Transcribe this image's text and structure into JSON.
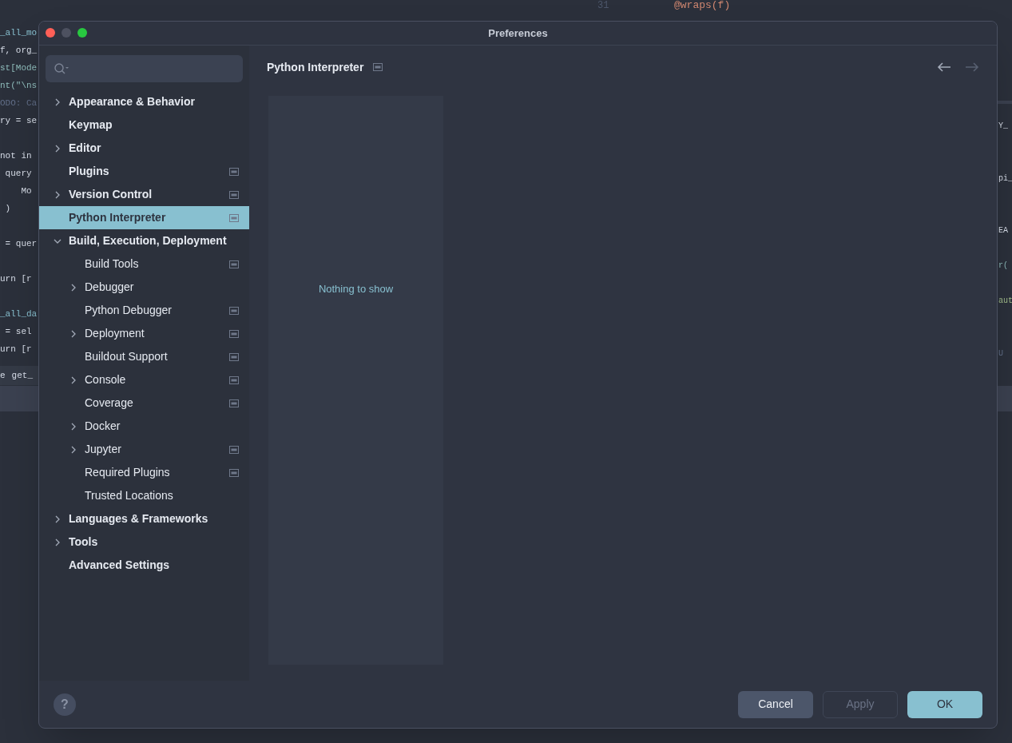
{
  "background_editor": {
    "line_number": "31",
    "top_code": "@wraps(f)",
    "left_lines": [
      {
        "text": "_all_mo",
        "kind": "name"
      },
      {
        "text": "f, org_",
        "kind": "plain"
      },
      {
        "text": "st[Mode",
        "kind": "type"
      },
      {
        "text": "nt(\"\\ns",
        "kind": "type"
      },
      {
        "text": "ODO: Ca",
        "kind": "comment"
      },
      {
        "text": "ry = se",
        "kind": "plain"
      },
      {
        "kind": "blank"
      },
      {
        "text": "not in",
        "kind": "plain"
      },
      {
        "text": " query",
        "kind": "plain"
      },
      {
        "text": "    Mo",
        "kind": "plain"
      },
      {
        "text": " )",
        "kind": "plain"
      },
      {
        "kind": "blank"
      },
      {
        "text": " = quer",
        "kind": "plain"
      },
      {
        "kind": "blank"
      },
      {
        "text": "urn [r",
        "kind": "plain"
      },
      {
        "kind": "blank"
      },
      {
        "text": "_all_da",
        "kind": "name"
      },
      {
        "text": " = sel",
        "kind": "plain"
      },
      {
        "text": "urn [r",
        "kind": "plain"
      }
    ],
    "breadcrumbs": [
      "e",
      "get_"
    ],
    "right_lines": [
      {
        "text": "Y_",
        "kind": "plain"
      },
      {
        "text": "pi_",
        "kind": "plain"
      },
      {
        "text": "EA",
        "kind": "plain"
      },
      {
        "text": "r(",
        "kind": "type"
      },
      {
        "text": "aut",
        "kind": "string"
      },
      {
        "text": "U",
        "kind": "comment"
      }
    ]
  },
  "dialog": {
    "title": "Preferences",
    "tree": [
      {
        "label": "Appearance & Behavior",
        "expanded": false,
        "selected": false,
        "project_icon": false
      },
      {
        "label": "Keymap",
        "selected": false,
        "project_icon": false
      },
      {
        "label": "Editor",
        "expanded": false,
        "selected": false,
        "project_icon": false
      },
      {
        "label": "Plugins",
        "selected": false,
        "project_icon": true
      },
      {
        "label": "Version Control",
        "expanded": false,
        "selected": false,
        "project_icon": true
      },
      {
        "label": "Python Interpreter",
        "selected": true,
        "project_icon": true
      },
      {
        "label": "Build, Execution, Deployment",
        "expanded": true,
        "selected": false,
        "project_icon": false,
        "children": [
          {
            "label": "Build Tools",
            "selected": false,
            "project_icon": true
          },
          {
            "label": "Debugger",
            "expanded": false,
            "selected": false,
            "project_icon": false
          },
          {
            "label": "Python Debugger",
            "selected": false,
            "project_icon": true
          },
          {
            "label": "Deployment",
            "expanded": false,
            "selected": false,
            "project_icon": true
          },
          {
            "label": "Buildout Support",
            "selected": false,
            "project_icon": true
          },
          {
            "label": "Console",
            "expanded": false,
            "selected": false,
            "project_icon": true
          },
          {
            "label": "Coverage",
            "selected": false,
            "project_icon": true
          },
          {
            "label": "Docker",
            "expanded": false,
            "selected": false,
            "project_icon": false
          },
          {
            "label": "Jupyter",
            "expanded": false,
            "selected": false,
            "project_icon": true
          },
          {
            "label": "Required Plugins",
            "selected": false,
            "project_icon": true
          },
          {
            "label": "Trusted Locations",
            "selected": false,
            "project_icon": false
          }
        ]
      },
      {
        "label": "Languages & Frameworks",
        "expanded": false,
        "selected": false,
        "project_icon": false
      },
      {
        "label": "Tools",
        "expanded": false,
        "selected": false,
        "project_icon": false
      },
      {
        "label": "Advanced Settings",
        "selected": false,
        "project_icon": false
      }
    ],
    "page": {
      "title": "Python Interpreter",
      "project_icon": true,
      "back_disabled": false,
      "forward_disabled": true,
      "empty_text": "Nothing to show"
    },
    "help_button": "?",
    "buttons": [
      {
        "label": "Cancel",
        "kind": "secondary",
        "disabled": false
      },
      {
        "label": "Apply",
        "kind": "secondary",
        "disabled": true
      },
      {
        "label": "OK",
        "kind": "primary",
        "disabled": false
      }
    ]
  }
}
